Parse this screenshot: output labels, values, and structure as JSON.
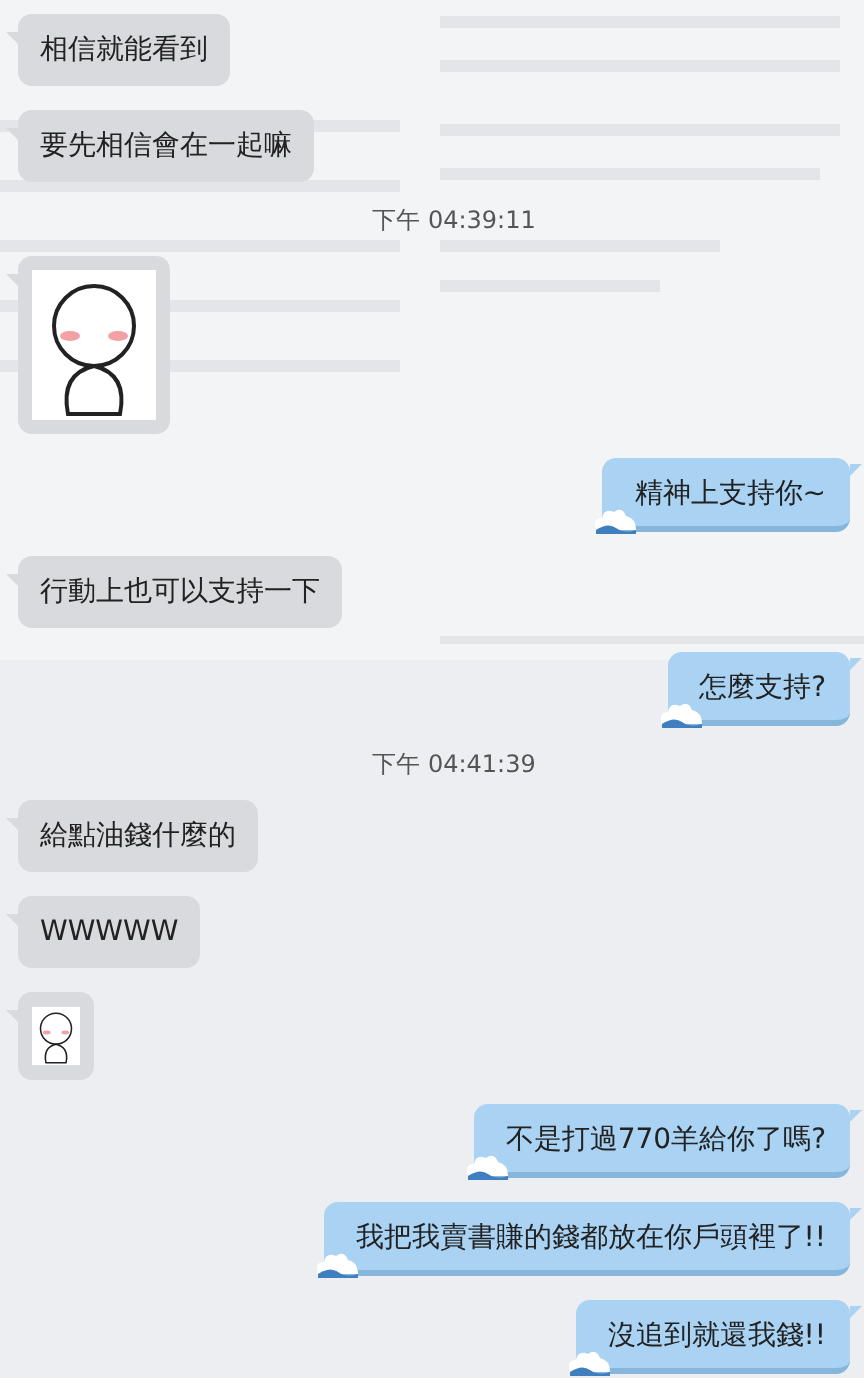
{
  "messages": [
    {
      "kind": "text",
      "outgoing": false,
      "text": "相信就能看到"
    },
    {
      "kind": "text",
      "outgoing": false,
      "text": "要先相信會在一起嘛"
    },
    {
      "kind": "time",
      "text": "下午 04:39:11"
    },
    {
      "kind": "sticker",
      "outgoing": false,
      "large": true
    },
    {
      "kind": "text",
      "outgoing": true,
      "text": "精神上支持你~"
    },
    {
      "kind": "text",
      "outgoing": false,
      "text": "行動上也可以支持一下"
    },
    {
      "kind": "text",
      "outgoing": true,
      "text": "怎麼支持?"
    },
    {
      "kind": "time",
      "text": "下午 04:41:39"
    },
    {
      "kind": "text",
      "outgoing": false,
      "text": "給點油錢什麼的"
    },
    {
      "kind": "text",
      "outgoing": false,
      "text": "WWWWW"
    },
    {
      "kind": "sticker",
      "outgoing": false,
      "large": false
    },
    {
      "kind": "text",
      "outgoing": true,
      "text": "不是打過770羊給你了嗎?"
    },
    {
      "kind": "text",
      "outgoing": true,
      "text": "我把我賣書賺的錢都放在你戶頭裡了!!"
    },
    {
      "kind": "text",
      "outgoing": true,
      "text": "沒追到就還我錢!!"
    }
  ]
}
